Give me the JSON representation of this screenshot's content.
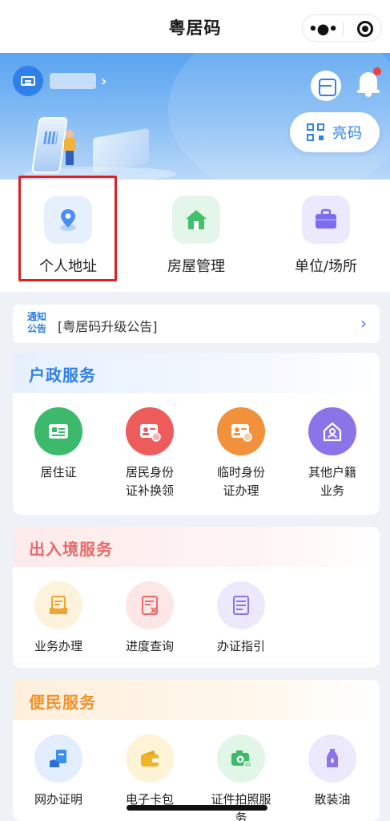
{
  "navbar": {
    "title": "粤居码"
  },
  "banner": {
    "qr_button_label": "亮码"
  },
  "top_menu": [
    {
      "label": "个人地址",
      "icon": "location-pin-icon",
      "color": "#4a8ff0"
    },
    {
      "label": "房屋管理",
      "icon": "house-icon",
      "color": "#43c16a"
    },
    {
      "label": "单位/场所",
      "icon": "briefcase-icon",
      "color": "#7b6cf0"
    }
  ],
  "notice": {
    "tag_line1": "通知",
    "tag_line2": "公告",
    "text": "[粤居码升级公告]"
  },
  "sections": [
    {
      "title": "户政服务",
      "title_color": "#2f80e8",
      "items": [
        {
          "label": "居住证",
          "icon": "id-card-icon",
          "color": "#3cb96b"
        },
        {
          "label": "居民身份\n证补换领",
          "icon": "id-card-swap-icon",
          "color": "#ee5b5b"
        },
        {
          "label": "临时身份\n证办理",
          "icon": "temp-id-card-icon",
          "color": "#f2913c"
        },
        {
          "label": "其他户籍\n业务",
          "icon": "house-person-icon",
          "color": "#8a74e8"
        }
      ]
    },
    {
      "title": "出入境服务",
      "title_color": "#e76a6a",
      "items": [
        {
          "label": "业务办理",
          "icon": "document-tray-icon",
          "color": "#f1a52f"
        },
        {
          "label": "进度查询",
          "icon": "document-cross-icon",
          "color": "#ee6a6a"
        },
        {
          "label": "办证指引",
          "icon": "document-lines-icon",
          "color": "#8a74e8"
        }
      ]
    },
    {
      "title": "便民服务",
      "title_color": "#f0922c",
      "items": [
        {
          "label": "网办证明",
          "icon": "certificate-hand-icon",
          "color": "#3b8ff0"
        },
        {
          "label": "电子卡包",
          "icon": "wallet-icon",
          "color": "#f1b32a"
        },
        {
          "label": "证件拍照服\n务",
          "icon": "camera-id-icon",
          "color": "#3cb96b"
        },
        {
          "label": "散装油",
          "icon": "oil-bottle-icon",
          "color": "#8a74e8"
        }
      ]
    }
  ]
}
